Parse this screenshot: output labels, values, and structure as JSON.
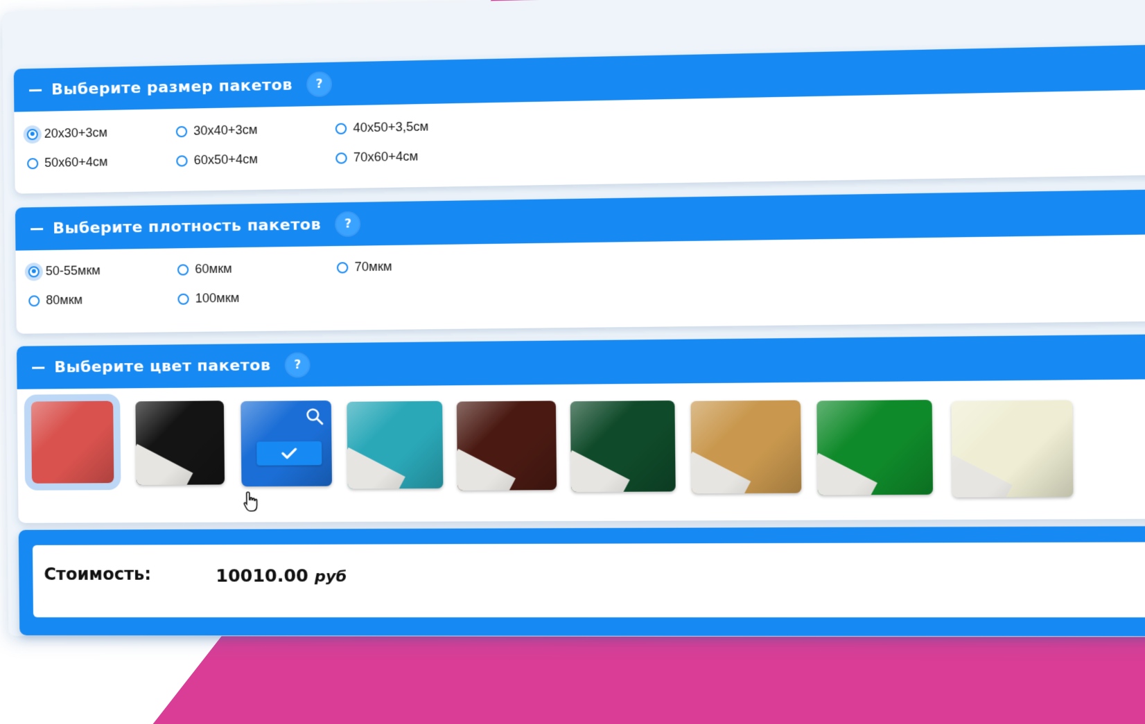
{
  "size_section": {
    "title": "Выберите размер пакетов",
    "help": "?",
    "options": [
      {
        "label": "20x30+3см",
        "checked": true
      },
      {
        "label": "30x40+3см",
        "checked": false
      },
      {
        "label": "40x50+3,5см",
        "checked": false
      },
      {
        "label": "50x60+4см",
        "checked": false
      },
      {
        "label": "60x50+4см",
        "checked": false
      },
      {
        "label": "70x60+4см",
        "checked": false
      }
    ]
  },
  "density_section": {
    "title": "Выберите плотность пакетов",
    "help": "?",
    "options": [
      {
        "label": "50-55мкм",
        "checked": true
      },
      {
        "label": "60мкм",
        "checked": false
      },
      {
        "label": "70мкм",
        "checked": false
      },
      {
        "label": "80мкм",
        "checked": false
      },
      {
        "label": "100мкм",
        "checked": false
      }
    ]
  },
  "color_section": {
    "title": "Выберите цвет пакетов",
    "help": "?",
    "swatches": [
      {
        "color": "#d9524e",
        "selected": true,
        "hovered": false
      },
      {
        "color": "#141414",
        "selected": false,
        "hovered": false
      },
      {
        "color": "#1b6ed6",
        "selected": false,
        "hovered": true
      },
      {
        "color": "#2aa8b8",
        "selected": false,
        "hovered": false
      },
      {
        "color": "#4a1a12",
        "selected": false,
        "hovered": false
      },
      {
        "color": "#0f4a2a",
        "selected": false,
        "hovered": false
      },
      {
        "color": "#c9984e",
        "selected": false,
        "hovered": false
      },
      {
        "color": "#0f8a2a",
        "selected": false,
        "hovered": false
      },
      {
        "color": "#efeed4",
        "selected": false,
        "hovered": false
      }
    ],
    "icons": {
      "zoom": "zoom-icon",
      "check": "check-icon",
      "cursor": "hand-cursor-icon"
    }
  },
  "total": {
    "label": "Стоимость:",
    "amount": "10010.00",
    "unit": "руб"
  },
  "colors": {
    "accent": "#1789f3",
    "background_stripe": "#d93d96"
  }
}
